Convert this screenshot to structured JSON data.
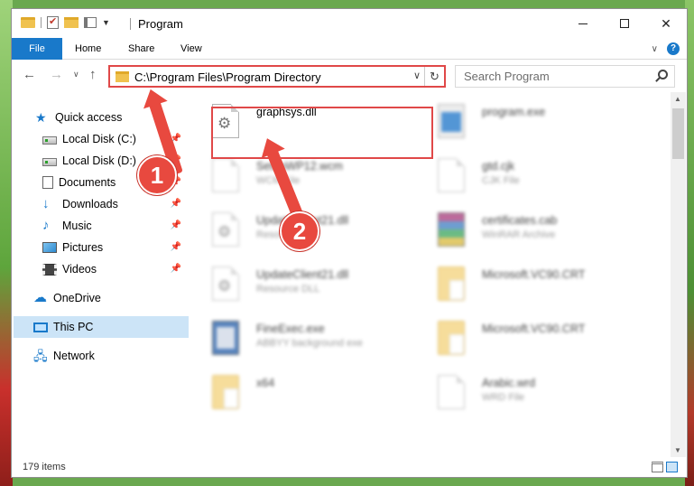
{
  "window": {
    "title": "Program",
    "minimize_label": "─",
    "close_label": "✕"
  },
  "ribbon": {
    "tabs": [
      "File",
      "Home",
      "Share",
      "View"
    ],
    "collapse_glyph": "∨",
    "help_glyph": "?"
  },
  "address": {
    "path": "C:\\Program Files\\Program Directory",
    "dropdown_glyph": "∨",
    "refresh_glyph": "↻"
  },
  "search": {
    "placeholder": "Search Program"
  },
  "nav": {
    "back_glyph": "←",
    "forward_glyph": "→",
    "recent_glyph": "∨",
    "up_glyph": "↑"
  },
  "sidebar": {
    "items": [
      {
        "label": "Quick access",
        "icon": "star-icon"
      },
      {
        "label": "Local Disk (C:)",
        "icon": "drive-icon",
        "pinned": true
      },
      {
        "label": "Local Disk (D:)",
        "icon": "drive-icon",
        "pinned": true
      },
      {
        "label": "Documents",
        "icon": "document-icon",
        "pinned": true
      },
      {
        "label": "Downloads",
        "icon": "download-icon",
        "pinned": true
      },
      {
        "label": "Music",
        "icon": "music-icon",
        "pinned": true
      },
      {
        "label": "Pictures",
        "icon": "picture-icon",
        "pinned": true
      },
      {
        "label": "Videos",
        "icon": "video-icon",
        "pinned": true
      },
      {
        "label": "OneDrive",
        "icon": "cloud-icon"
      },
      {
        "label": "This PC",
        "icon": "computer-icon",
        "selected": true
      },
      {
        "label": "Network",
        "icon": "network-icon"
      }
    ]
  },
  "files": [
    {
      "name": "graphsys.dll",
      "type": "",
      "icon": "dll-icon",
      "highlighted": true
    },
    {
      "name": "program.exe",
      "type": "",
      "icon": "app-icon"
    },
    {
      "name": "SetupWP12.wcm",
      "type": "WCM File",
      "icon": "file-icon"
    },
    {
      "name": "gtd.cjk",
      "type": "CJK File",
      "icon": "file-icon"
    },
    {
      "name": "UpdateClient21.dll",
      "type": "Resource DLL",
      "icon": "dll-icon"
    },
    {
      "name": "certificates.cab",
      "type": "WinRAR Archive",
      "icon": "rar-icon"
    },
    {
      "name": "UpdateClient21.dll",
      "type": "Resource DLL",
      "icon": "dll-icon"
    },
    {
      "name": "Microsoft.VC90.CRT",
      "type": "",
      "icon": "folder-icon"
    },
    {
      "name": "FineExec.exe",
      "type": "ABBYY background exe",
      "icon": "exe-icon"
    },
    {
      "name": "Microsoft.VC90.CRT",
      "type": "",
      "icon": "folder-icon"
    },
    {
      "name": "x64",
      "type": "",
      "icon": "folder-icon"
    },
    {
      "name": "Arabic.wrd",
      "type": "WRD File",
      "icon": "file-icon"
    }
  ],
  "status": {
    "item_count": "179 items"
  },
  "annotations": {
    "step1": "1",
    "step2": "2",
    "color": "#e8493f"
  }
}
